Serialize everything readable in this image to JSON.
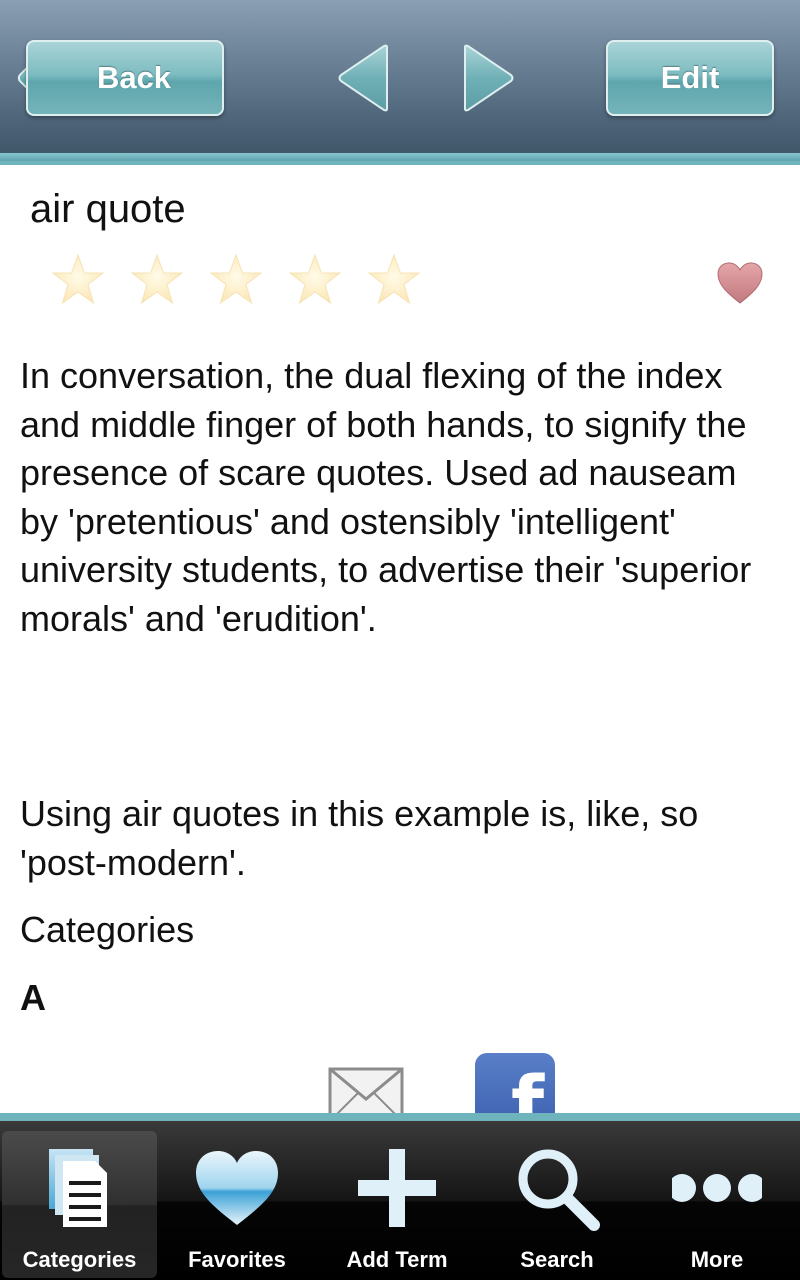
{
  "navbar": {
    "back_label": "Back",
    "edit_label": "Edit",
    "prev_icon": "arrow-left-icon",
    "next_icon": "arrow-right-icon",
    "accent_color": "#6fb3bd"
  },
  "term": {
    "title": "air quote",
    "rating": {
      "filled": 0,
      "max": 5
    },
    "favorite_icon": "heart-icon",
    "definition": "In conversation, the dual flexing of the index and middle finger of both hands, to signify the presence of scare quotes. Used ad nauseam by 'pretentious' and ostensibly 'intelligent' university students, to advertise their 'superior morals' and 'erudition'.",
    "example": "Using air quotes in this example is, like, so 'post-modern'.",
    "categories_label": "Categories",
    "category_value": "A"
  },
  "share": {
    "email_icon": "envelope-icon",
    "facebook_icon": "facebook-icon",
    "facebook_glyph": "f"
  },
  "tabbar": {
    "tabs": [
      {
        "label": "Categories",
        "icon": "categories-icon",
        "active": true
      },
      {
        "label": "Favorites",
        "icon": "heart-icon",
        "active": false
      },
      {
        "label": "Add Term",
        "icon": "plus-icon",
        "active": false
      },
      {
        "label": "Search",
        "icon": "search-icon",
        "active": false
      },
      {
        "label": "More",
        "icon": "more-dots-icon",
        "active": false
      }
    ]
  }
}
